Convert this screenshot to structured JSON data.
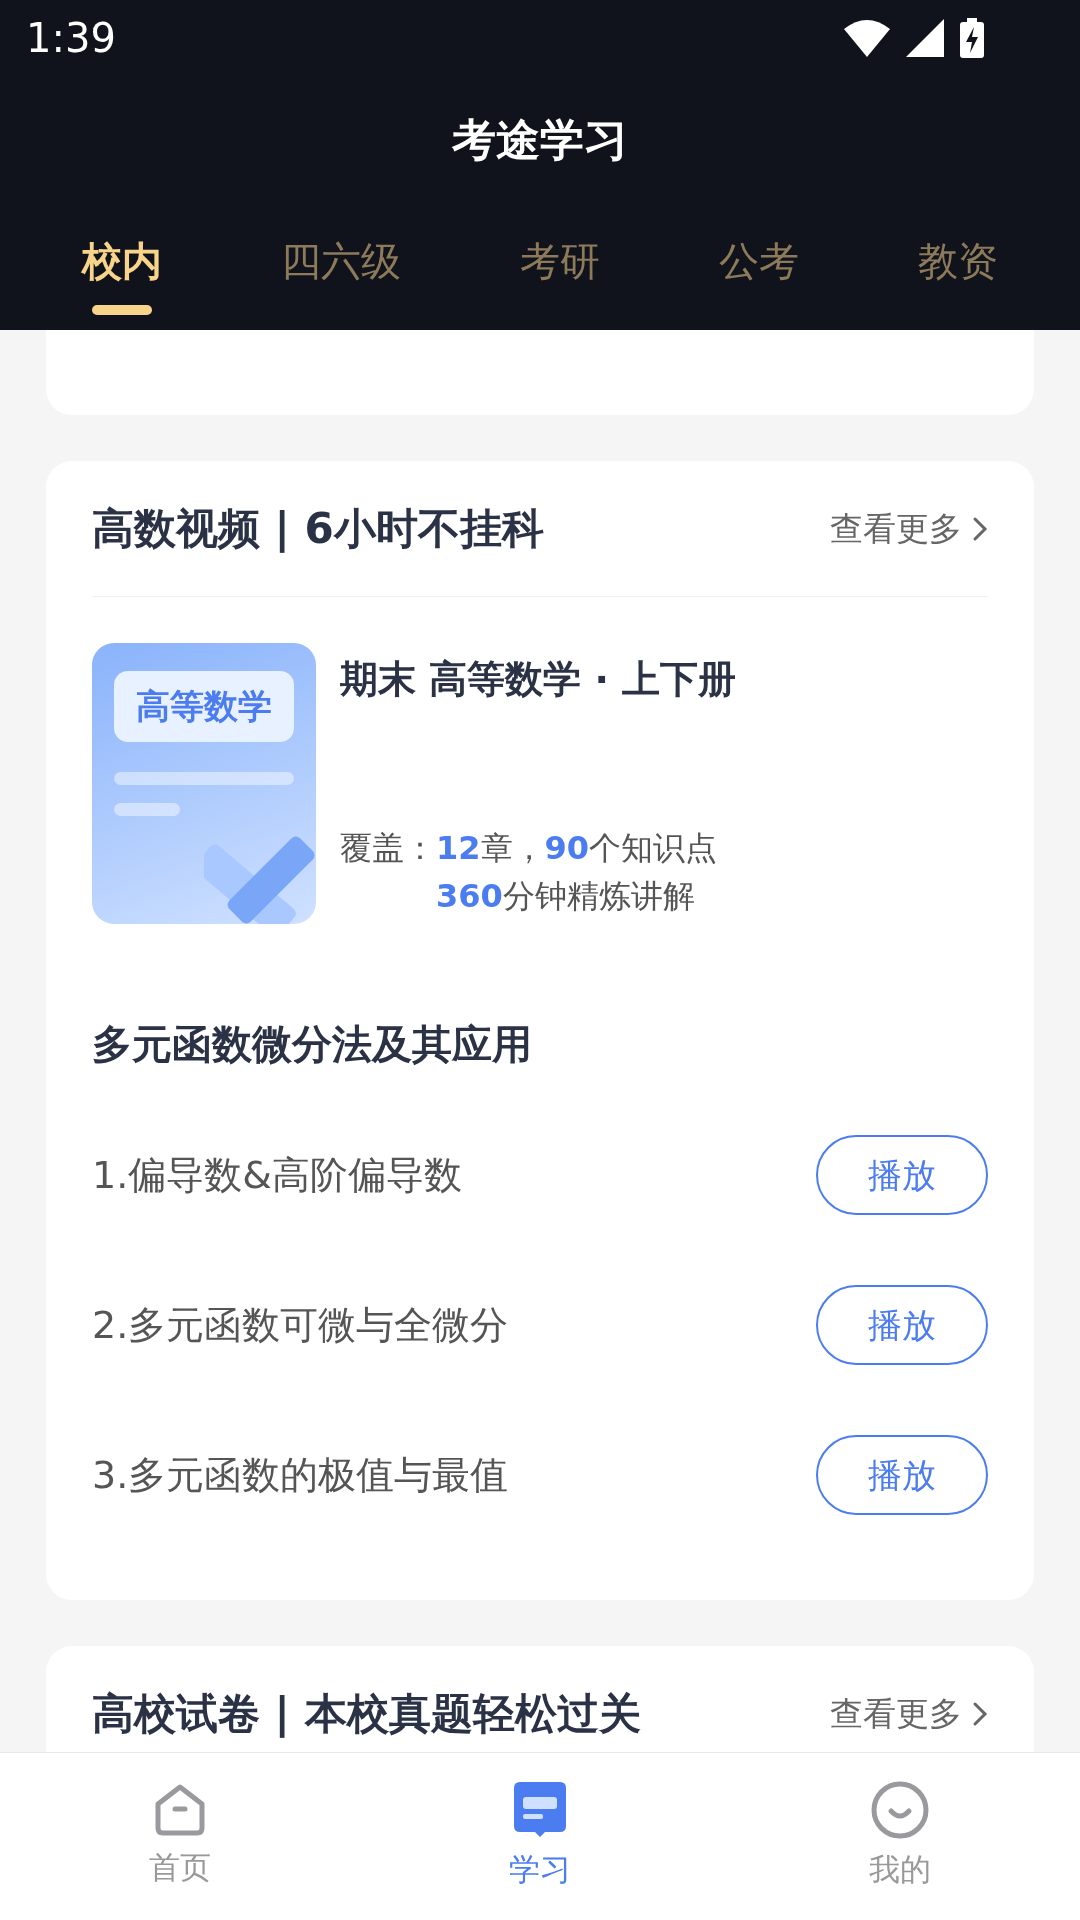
{
  "status_bar": {
    "time": "1:39"
  },
  "header": {
    "title": "考途学习"
  },
  "tabs": [
    {
      "label": "校内",
      "selected": true
    },
    {
      "label": "四六级",
      "selected": false
    },
    {
      "label": "考研",
      "selected": false
    },
    {
      "label": "公考",
      "selected": false
    },
    {
      "label": "教资",
      "selected": false
    }
  ],
  "sections": [
    {
      "title": "高数视频 | 6小时不挂科",
      "more": "查看更多",
      "course": {
        "cover_label": "高等数学",
        "title": "期末 高等数学 · 上下册",
        "coverage_label": "覆盖：",
        "coverage_line1": "**12**章，**90**个知识点",
        "coverage_line2": "**360**分钟精炼讲解"
      },
      "chapter": "多元函数微分法及其应用",
      "lessons": [
        {
          "title": "1.偏导数&高阶偏导数",
          "button": "播放"
        },
        {
          "title": "2.多元函数可微与全微分",
          "button": "播放"
        },
        {
          "title": "3.多元函数的极值与最值",
          "button": "播放"
        }
      ]
    },
    {
      "title": "高校试卷 | 本校真题轻松过关",
      "more": "查看更多"
    }
  ],
  "bottom_nav": [
    {
      "label": "首页",
      "kind": "home",
      "selected": false
    },
    {
      "label": "学习",
      "kind": "study",
      "selected": true
    },
    {
      "label": "我的",
      "kind": "me",
      "selected": false
    }
  ]
}
